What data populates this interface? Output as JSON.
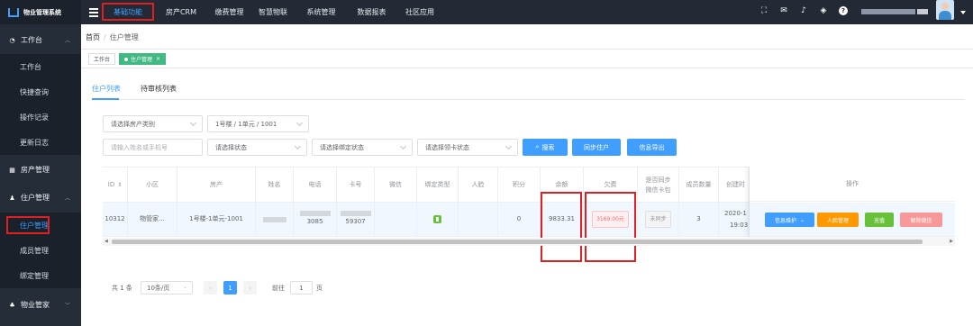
{
  "app": {
    "title": "物业管理系统"
  },
  "topnav": {
    "items": [
      "基础功能",
      "房产CRM",
      "缴费管理",
      "智慧物联",
      "系统管理",
      "数据报表",
      "社区应用"
    ]
  },
  "sidebar": {
    "groups": [
      {
        "label": "工作台",
        "items": [
          "工作台",
          "快捷查询",
          "操作记录",
          "更新日志"
        ]
      },
      {
        "label": "房产管理"
      },
      {
        "label": "住户管理",
        "items": [
          "住户管理",
          "成员管理",
          "绑定管理"
        ]
      },
      {
        "label": "物业管家"
      }
    ]
  },
  "breadcrumb": {
    "home": "首页",
    "current": "住户管理"
  },
  "tags": {
    "home": "工作台",
    "active": "住户管理",
    "close": "×"
  },
  "tabs": [
    "住户列表",
    "待审核列表"
  ],
  "filters": {
    "house_type": "请选择房产类别",
    "house": "1号楼 / 1单元 / 1001",
    "name_phone": "请输入姓名或手机号",
    "status": "请选择状态",
    "bind_status": "请选择绑定状态",
    "card_status": "请选择领卡状态",
    "search": "搜索",
    "sync": "同步住户",
    "export": "信息导出"
  },
  "table": {
    "headers": {
      "id": "ID",
      "community": "小区",
      "house": "房产",
      "name": "姓名",
      "phone": "电话",
      "card": "卡号",
      "wechat": "微信",
      "bind_type": "绑定类型",
      "face": "人脸",
      "points": "积分",
      "balance": "余额",
      "arrears": "欠费",
      "sync_wechat": "是否同步微信卡包",
      "members": "成员数量",
      "created": "创建时",
      "ops": "操作"
    },
    "rows": [
      {
        "id": "10312",
        "community": "物管家...",
        "house": "1号楼-1单元-1001",
        "phone": "3085",
        "card": "59307",
        "points": "0",
        "balance": "9833.31",
        "arrears": "3169.00元",
        "sync_wechat": "未同步",
        "members": "3",
        "created_line1": "2020-1",
        "created_line2": "19:03"
      }
    ],
    "ops": {
      "info": "信息维护",
      "face": "人脸管理",
      "recharge": "充值",
      "unbind": "解除微信"
    }
  },
  "pager": {
    "total": "共 1 条",
    "page_size": "10条/页",
    "current_page": "1",
    "goto_label": "前往",
    "goto_value": "1",
    "page_unit": "页"
  },
  "colors": {
    "primary": "#409eff",
    "highlight": "#e02020",
    "success": "#67c23a",
    "warning": "#ff9900",
    "danger": "#f89898",
    "sidebar": "#252d38"
  }
}
